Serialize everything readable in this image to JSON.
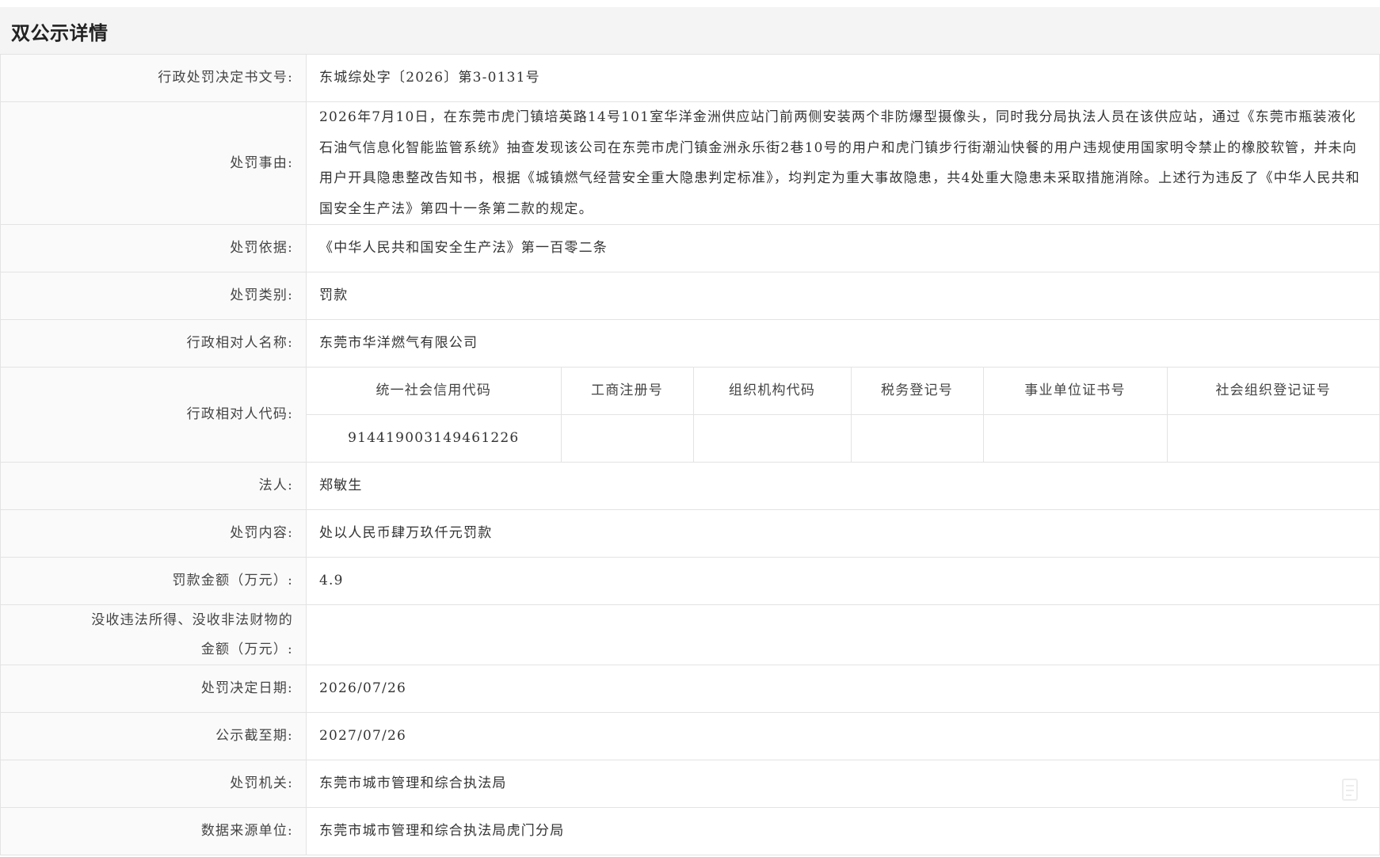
{
  "header": {
    "title": "双公示详情"
  },
  "rows": {
    "doc_no": {
      "label": "行政处罚决定书文号:",
      "value": "东城综处字〔2026〕第3-0131号"
    },
    "reason": {
      "label": "处罚事由:",
      "value": "2026年7月10日，在东莞市虎门镇培英路14号101室华洋金洲供应站门前两侧安装两个非防爆型摄像头，同时我分局执法人员在该供应站，通过《东莞市瓶装液化石油气信息化智能监管系统》抽查发现该公司在东莞市虎门镇金洲永乐街2巷10号的用户和虎门镇步行街潮汕快餐的用户违规使用国家明令禁止的橡胶软管，并未向用户开具隐患整改告知书，根据《城镇燃气经营安全重大隐患判定标准》，均判定为重大事故隐患，共4处重大隐患未采取措施消除。上述行为违反了《中华人民共和国安全生产法》第四十一条第二款的规定。"
    },
    "basis": {
      "label": "处罚依据:",
      "value": "《中华人民共和国安全生产法》第一百零二条"
    },
    "category": {
      "label": "处罚类别:",
      "value": "罚款"
    },
    "party_name": {
      "label": "行政相对人名称:",
      "value": "东莞市华洋燃气有限公司"
    },
    "party_code": {
      "label": "行政相对人代码:",
      "headers": [
        "统一社会信用代码",
        "工商注册号",
        "组织机构代码",
        "税务登记号",
        "事业单位证书号",
        "社会组织登记证号"
      ],
      "values": [
        "914419003149461226",
        "",
        "",
        "",
        "",
        ""
      ]
    },
    "legal_person": {
      "label": "法人:",
      "value": "郑敏生"
    },
    "content": {
      "label": "处罚内容:",
      "value": "处以人民币肆万玖仟元罚款"
    },
    "fine": {
      "label": "罚款金额（万元）:",
      "value": "4.9"
    },
    "confiscation": {
      "label_line1": "没收违法所得、没收非法财物的",
      "label_line2": "金额（万元）:",
      "value": ""
    },
    "decision_date": {
      "label": "处罚决定日期:",
      "value": "2026/07/26"
    },
    "publicity_end": {
      "label": "公示截至期:",
      "value": "2027/07/26"
    },
    "authority": {
      "label": "处罚机关:",
      "value": "东莞市城市管理和综合执法局"
    },
    "data_source": {
      "label": "数据来源单位:",
      "value": "东莞市城市管理和综合执法局虎门分局"
    }
  }
}
